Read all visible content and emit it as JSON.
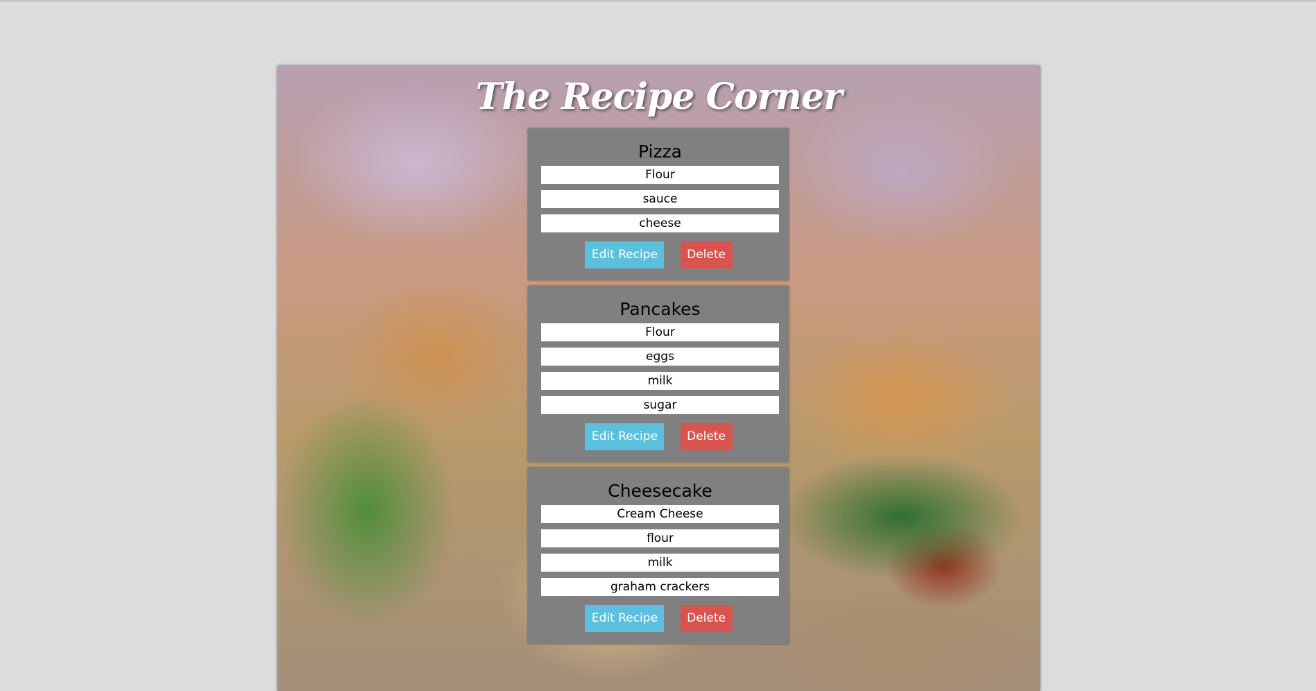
{
  "app": {
    "title": "The Recipe Corner"
  },
  "colors": {
    "page_background": "#dcdcdc",
    "card_background": "#808080",
    "edit_button": "#5bc0de",
    "delete_button": "#d9534f"
  },
  "recipes": [
    {
      "name": "Pizza",
      "ingredients": [
        "Flour",
        "sauce",
        "cheese"
      ],
      "edit_label": "Edit Recipe",
      "delete_label": "Delete"
    },
    {
      "name": "Pancakes",
      "ingredients": [
        "Flour",
        "eggs",
        "milk",
        "sugar"
      ],
      "edit_label": "Edit Recipe",
      "delete_label": "Delete"
    },
    {
      "name": "Cheesecake",
      "ingredients": [
        "Cream Cheese",
        "flour",
        "milk",
        "graham crackers"
      ],
      "edit_label": "Edit Recipe",
      "delete_label": "Delete"
    }
  ]
}
